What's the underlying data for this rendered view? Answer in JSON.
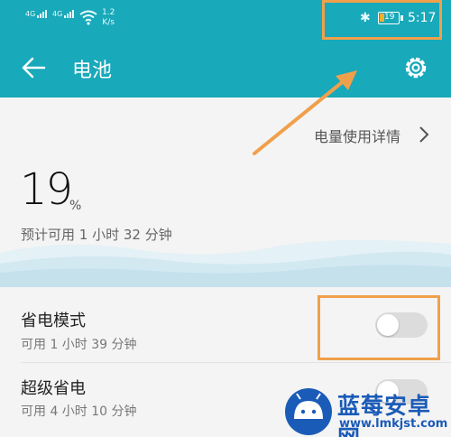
{
  "status_bar": {
    "signal1_type": "4G",
    "signal2_type": "4G",
    "net_speed_value": "1.2",
    "net_speed_unit": "K/s",
    "battery_level": "19",
    "time": "5:17"
  },
  "header": {
    "title": "电池"
  },
  "usage_details_link": "电量使用详情",
  "battery": {
    "percent": "19",
    "percent_sign": "%",
    "remaining": "预计可用 1 小时 32 分钟"
  },
  "power_saving": {
    "title": "省电模式",
    "subtitle": "可用 1 小时 39 分钟",
    "enabled": false
  },
  "ultra_saving": {
    "title": "超级省电",
    "subtitle": "可用 4 小时 10 分钟",
    "enabled": false
  },
  "watermark": {
    "name": "蓝莓安卓网",
    "url": "www.lmkjst.com"
  },
  "colors": {
    "header": "#18a9ba",
    "annotation": "#f0a04b",
    "watermark": "#1b5bb8"
  }
}
